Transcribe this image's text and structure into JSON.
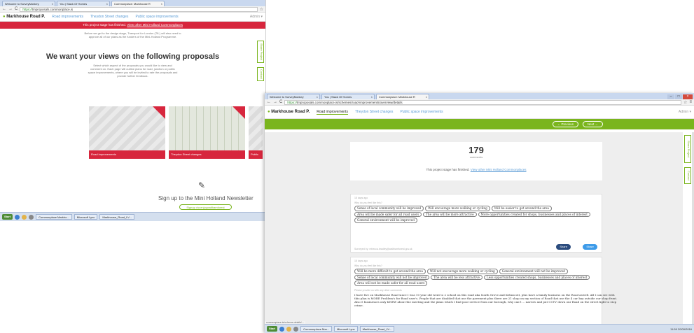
{
  "window1": {
    "tabs": [
      {
        "label": "Welcome to SurveyMonkey",
        "close": "×"
      },
      {
        "label": "You | Stack Of Homes",
        "close": "×"
      },
      {
        "label": "Commonplace: Markhouse R",
        "close": "×"
      }
    ],
    "address": {
      "prefix": "https://",
      "url": "tmproposals.commonplace.is"
    },
    "nav": {
      "brand": "Markhouse Road P.",
      "items": [
        "Road improvements",
        "Theydon Street changes",
        "Public space improvements"
      ],
      "admin": "Admin ▾"
    },
    "banner": {
      "text": "This project stage has finished.",
      "link": "View other Mini Holland Commonplaces"
    },
    "intro": "Before we get to the design stage, Transport for London (TfL) will also need to approve all of our plans as the funders of the Mini-Holland Programme.",
    "heading": "We want your views on the following proposals",
    "subtext": "Select which aspect of the proposals you would like to view and comment on. Each page will outline plans for road, junction or public space improvements, where you will be invited to rate the proposals and provide further feedback.",
    "cards": [
      "Road improvements",
      "Theydon Street changes",
      "Public spac"
    ],
    "newsletter": {
      "heading": "Sign up to the Mini Holland Newsletter",
      "button": "Signup via enjoywalthamforest"
    },
    "sidetabs": [
      "Share Project",
      "Contact"
    ],
    "taskbar": {
      "start": "Start",
      "apps": [
        "Commonplace Markho...",
        "Microsoft Lync",
        "Markhouse_Road_LV..."
      ]
    }
  },
  "window2": {
    "tabs": [
      {
        "label": "Welcome to SurveyMonkey",
        "close": "×"
      },
      {
        "label": "You | Stack Of Homes",
        "close": "×"
      },
      {
        "label": "Commonplace: Markhouse R",
        "close": "×"
      }
    ],
    "address": {
      "prefix": "https://",
      "url": "tmproposals.commonplace.is/schemes/road-improvements/overview/details"
    },
    "nav": {
      "brand": "Markhouse Road P.",
      "items": [
        "Road improvements",
        "Theydon Street changes",
        "Public space improvements"
      ],
      "admin": "Admin ▾"
    },
    "pager": {
      "previous": "← Previous",
      "next": "Next →"
    },
    "summary": {
      "count": "179",
      "count_label": "comments",
      "stage_text": "This project stage has finished.",
      "stage_link": "View other Mini Holland Commonplaces"
    },
    "response1": {
      "ago": "15 days ago",
      "question": "Why do you feel like this?",
      "chips": [
        "Sense of local community will be improved",
        "Will encourage more walking or cycling",
        "Will be easier to get around the area",
        "Area will be made safer for all road users",
        "The area will be more attractive",
        "More opportunities created for shops, businesses and places of interest",
        "General environment will be improved"
      ],
      "surveyed": "Surveyed by: rebecca.bradley@walthamforest.gov.uk",
      "share1": "Share",
      "share2": "Share"
    },
    "response2": {
      "ago": "15 days ago",
      "question": "Why do you feel like this?",
      "chips": [
        "Will be more difficult to get around the area",
        "Will not encourage more walking or cycling",
        "General environment will not be improved",
        "Sense of local community will not be improved",
        "The area will be less attractive",
        "Less opportunities created shops, businesses and places of interest",
        "Area will not be made safer for all road users"
      ],
      "comment_q": "Please provide us with any other comments",
      "comment": "I have live on Markhouse Road since I was 10 year old went to 2 school on this road aka South Grove and Kelmscott, plus have a family business on the Road aswell. All I can see with this plan is MORE Problem's for Road user's. People that are disabled that use the pavement plus there are 21 shop on my section of Road that use the 4 car bay outside our shop front. Also 5 businesses only KNEW about the meeting and the plans which I find poor service from our borough, why can't ... narrow and put CCTV down our Road on the street light to stop crime."
    },
    "sidetabs": [
      "Share Project",
      "Contact"
    ],
    "status_url": "commonplace.is/scheme-details/...",
    "taskbar": {
      "start": "Start",
      "apps": [
        "Commonplace Mar...",
        "Microsoft Lync",
        "Markhouse_Road_LV..."
      ],
      "tray": "11:59 20/09/2016"
    }
  }
}
